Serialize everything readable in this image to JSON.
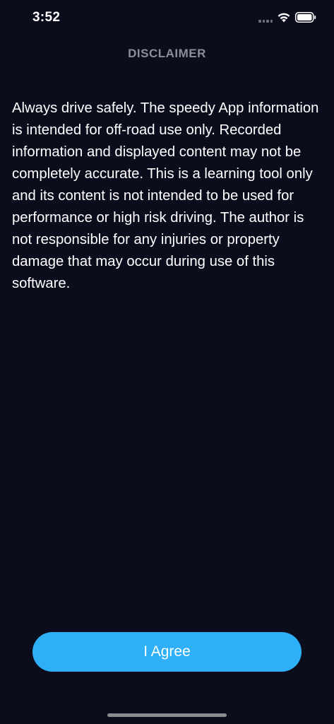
{
  "status_bar": {
    "time": "3:52"
  },
  "nav": {
    "title": "DISCLAIMER"
  },
  "content": {
    "disclaimer": "Always drive safely. The speedy App information is intended for off-road use only. Recorded information and displayed content may not be completely accurate. This is a learning tool only and its content is not intended to be used for performance or high risk driving. The author is not responsible for any injuries or property damage that may occur during use of this software."
  },
  "actions": {
    "agree_label": "I Agree"
  },
  "colors": {
    "background": "#0b0d1d",
    "accent": "#2eaff8",
    "title_gray": "#8c8e98"
  }
}
